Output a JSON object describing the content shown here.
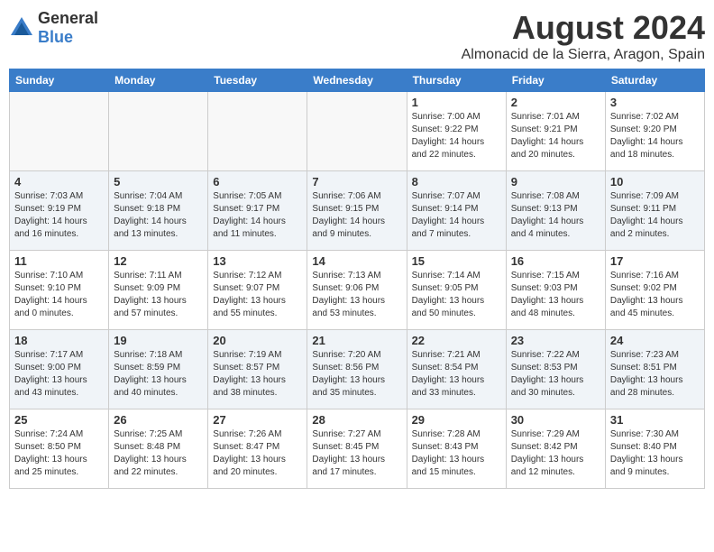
{
  "header": {
    "logo_general": "General",
    "logo_blue": "Blue",
    "month_year": "August 2024",
    "location": "Almonacid de la Sierra, Aragon, Spain"
  },
  "days_of_week": [
    "Sunday",
    "Monday",
    "Tuesday",
    "Wednesday",
    "Thursday",
    "Friday",
    "Saturday"
  ],
  "weeks": [
    [
      {
        "day": "",
        "info": ""
      },
      {
        "day": "",
        "info": ""
      },
      {
        "day": "",
        "info": ""
      },
      {
        "day": "",
        "info": ""
      },
      {
        "day": "1",
        "info": "Sunrise: 7:00 AM\nSunset: 9:22 PM\nDaylight: 14 hours\nand 22 minutes."
      },
      {
        "day": "2",
        "info": "Sunrise: 7:01 AM\nSunset: 9:21 PM\nDaylight: 14 hours\nand 20 minutes."
      },
      {
        "day": "3",
        "info": "Sunrise: 7:02 AM\nSunset: 9:20 PM\nDaylight: 14 hours\nand 18 minutes."
      }
    ],
    [
      {
        "day": "4",
        "info": "Sunrise: 7:03 AM\nSunset: 9:19 PM\nDaylight: 14 hours\nand 16 minutes."
      },
      {
        "day": "5",
        "info": "Sunrise: 7:04 AM\nSunset: 9:18 PM\nDaylight: 14 hours\nand 13 minutes."
      },
      {
        "day": "6",
        "info": "Sunrise: 7:05 AM\nSunset: 9:17 PM\nDaylight: 14 hours\nand 11 minutes."
      },
      {
        "day": "7",
        "info": "Sunrise: 7:06 AM\nSunset: 9:15 PM\nDaylight: 14 hours\nand 9 minutes."
      },
      {
        "day": "8",
        "info": "Sunrise: 7:07 AM\nSunset: 9:14 PM\nDaylight: 14 hours\nand 7 minutes."
      },
      {
        "day": "9",
        "info": "Sunrise: 7:08 AM\nSunset: 9:13 PM\nDaylight: 14 hours\nand 4 minutes."
      },
      {
        "day": "10",
        "info": "Sunrise: 7:09 AM\nSunset: 9:11 PM\nDaylight: 14 hours\nand 2 minutes."
      }
    ],
    [
      {
        "day": "11",
        "info": "Sunrise: 7:10 AM\nSunset: 9:10 PM\nDaylight: 14 hours\nand 0 minutes."
      },
      {
        "day": "12",
        "info": "Sunrise: 7:11 AM\nSunset: 9:09 PM\nDaylight: 13 hours\nand 57 minutes."
      },
      {
        "day": "13",
        "info": "Sunrise: 7:12 AM\nSunset: 9:07 PM\nDaylight: 13 hours\nand 55 minutes."
      },
      {
        "day": "14",
        "info": "Sunrise: 7:13 AM\nSunset: 9:06 PM\nDaylight: 13 hours\nand 53 minutes."
      },
      {
        "day": "15",
        "info": "Sunrise: 7:14 AM\nSunset: 9:05 PM\nDaylight: 13 hours\nand 50 minutes."
      },
      {
        "day": "16",
        "info": "Sunrise: 7:15 AM\nSunset: 9:03 PM\nDaylight: 13 hours\nand 48 minutes."
      },
      {
        "day": "17",
        "info": "Sunrise: 7:16 AM\nSunset: 9:02 PM\nDaylight: 13 hours\nand 45 minutes."
      }
    ],
    [
      {
        "day": "18",
        "info": "Sunrise: 7:17 AM\nSunset: 9:00 PM\nDaylight: 13 hours\nand 43 minutes."
      },
      {
        "day": "19",
        "info": "Sunrise: 7:18 AM\nSunset: 8:59 PM\nDaylight: 13 hours\nand 40 minutes."
      },
      {
        "day": "20",
        "info": "Sunrise: 7:19 AM\nSunset: 8:57 PM\nDaylight: 13 hours\nand 38 minutes."
      },
      {
        "day": "21",
        "info": "Sunrise: 7:20 AM\nSunset: 8:56 PM\nDaylight: 13 hours\nand 35 minutes."
      },
      {
        "day": "22",
        "info": "Sunrise: 7:21 AM\nSunset: 8:54 PM\nDaylight: 13 hours\nand 33 minutes."
      },
      {
        "day": "23",
        "info": "Sunrise: 7:22 AM\nSunset: 8:53 PM\nDaylight: 13 hours\nand 30 minutes."
      },
      {
        "day": "24",
        "info": "Sunrise: 7:23 AM\nSunset: 8:51 PM\nDaylight: 13 hours\nand 28 minutes."
      }
    ],
    [
      {
        "day": "25",
        "info": "Sunrise: 7:24 AM\nSunset: 8:50 PM\nDaylight: 13 hours\nand 25 minutes."
      },
      {
        "day": "26",
        "info": "Sunrise: 7:25 AM\nSunset: 8:48 PM\nDaylight: 13 hours\nand 22 minutes."
      },
      {
        "day": "27",
        "info": "Sunrise: 7:26 AM\nSunset: 8:47 PM\nDaylight: 13 hours\nand 20 minutes."
      },
      {
        "day": "28",
        "info": "Sunrise: 7:27 AM\nSunset: 8:45 PM\nDaylight: 13 hours\nand 17 minutes."
      },
      {
        "day": "29",
        "info": "Sunrise: 7:28 AM\nSunset: 8:43 PM\nDaylight: 13 hours\nand 15 minutes."
      },
      {
        "day": "30",
        "info": "Sunrise: 7:29 AM\nSunset: 8:42 PM\nDaylight: 13 hours\nand 12 minutes."
      },
      {
        "day": "31",
        "info": "Sunrise: 7:30 AM\nSunset: 8:40 PM\nDaylight: 13 hours\nand 9 minutes."
      }
    ]
  ]
}
